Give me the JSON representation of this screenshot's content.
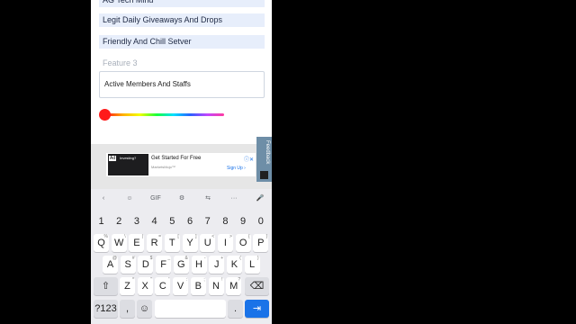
{
  "form": {
    "chip_top": "AG Tech Mind",
    "chip_1": "Legit Daily Giveaways And Drops",
    "chip_2": "Friendly And Chill Setver",
    "feature_label": "Feature 3",
    "feature_value": "Active Members And Staffs"
  },
  "color_slider": {
    "level": 0.0,
    "thumb_color": "#ff1a1a"
  },
  "ad": {
    "badge": "Ad",
    "small": "Investing?",
    "headline": "Get Started For Free",
    "sub": "MarketsMojo™",
    "cta": "Sign Up ›"
  },
  "feedback": {
    "label": "Feedback"
  },
  "keyboard": {
    "toolbar": [
      "‹",
      "☺",
      "GIF",
      "⚙",
      "⇆",
      "···",
      "🎤"
    ],
    "numbers": [
      "1",
      "2",
      "3",
      "4",
      "5",
      "6",
      "7",
      "8",
      "9",
      "0"
    ],
    "row1": [
      {
        "k": "Q",
        "s": "%"
      },
      {
        "k": "W",
        "s": "\\"
      },
      {
        "k": "E",
        "s": "|"
      },
      {
        "k": "R",
        "s": "="
      },
      {
        "k": "T",
        "s": "["
      },
      {
        "k": "Y",
        "s": "]"
      },
      {
        "k": "U",
        "s": "<"
      },
      {
        "k": "I",
        "s": ">"
      },
      {
        "k": "O",
        "s": "{"
      },
      {
        "k": "P",
        "s": "}"
      }
    ],
    "row2": [
      {
        "k": "A",
        "s": "@"
      },
      {
        "k": "S",
        "s": "#"
      },
      {
        "k": "D",
        "s": "$"
      },
      {
        "k": "F",
        "s": "_"
      },
      {
        "k": "G",
        "s": "&"
      },
      {
        "k": "H",
        "s": "-"
      },
      {
        "k": "J",
        "s": "+"
      },
      {
        "k": "K",
        "s": "("
      },
      {
        "k": "L",
        "s": ")"
      }
    ],
    "row3": [
      {
        "k": "Z",
        "s": "*"
      },
      {
        "k": "X",
        "s": "\""
      },
      {
        "k": "C",
        "s": "'"
      },
      {
        "k": "V",
        "s": ":"
      },
      {
        "k": "B",
        "s": ";"
      },
      {
        "k": "N",
        "s": "!"
      },
      {
        "k": "M",
        "s": "?"
      }
    ],
    "shift": "⇧",
    "backspace": "⌫",
    "symbols": "?123",
    "comma": ",",
    "emoji": "☺",
    "period": ".",
    "enter": "⇥"
  }
}
